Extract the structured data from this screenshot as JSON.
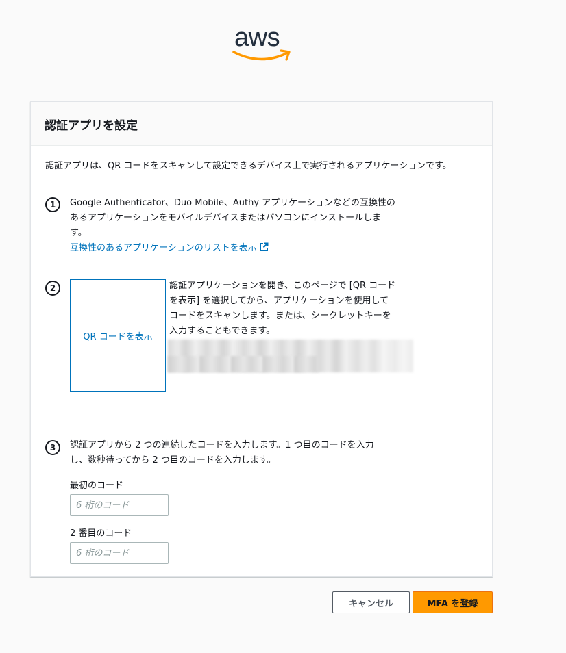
{
  "brand": {
    "logo_text": "aws",
    "logo_icon": "aws-smile-arrow",
    "accent": "#ff9900"
  },
  "card": {
    "title": "認証アプリを設定",
    "intro": "認証アプリは、QR コードをスキャンして設定できるデバイス上で実行されるアプリケーションです。"
  },
  "steps": [
    {
      "number": "1",
      "text_line1": "Google Authenticator、Duo Mobile、Authy アプリケーションなどの互換性の",
      "text_line2": "あるアプリケーションをモバイルデバイスまたはパソコンにインストールしま",
      "text_line3": "す。",
      "link_label": "互換性のあるアプリケーションのリストを表示",
      "link_icon": "external-link-icon"
    },
    {
      "number": "2",
      "qr_button_label": "QR コードを表示",
      "text_line1": "認証アプリケーションを開き、このページで [QR コード",
      "text_line2": "を表示] を選択してから、アプリケーションを使用して",
      "text_line3": "コードをスキャンします。または、シークレットキーを",
      "text_line4": "入力することもできます。"
    },
    {
      "number": "3",
      "text_line1": "認証アプリから 2 つの連続したコードを入力します。1 つ目のコードを入力",
      "text_line2": "し、数秒待ってから 2 つ目のコードを入力します。",
      "first_code_label": "最初のコード",
      "first_code_placeholder": "6 桁のコード",
      "first_code_value": "",
      "second_code_label": "2 番目のコード",
      "second_code_placeholder": "6 桁のコード",
      "second_code_value": ""
    }
  ],
  "actions": {
    "cancel_label": "キャンセル",
    "submit_label": "MFA を登録"
  },
  "colors": {
    "link": "#0073bb",
    "primary_button": "#ff9900",
    "text": "#16191f"
  }
}
